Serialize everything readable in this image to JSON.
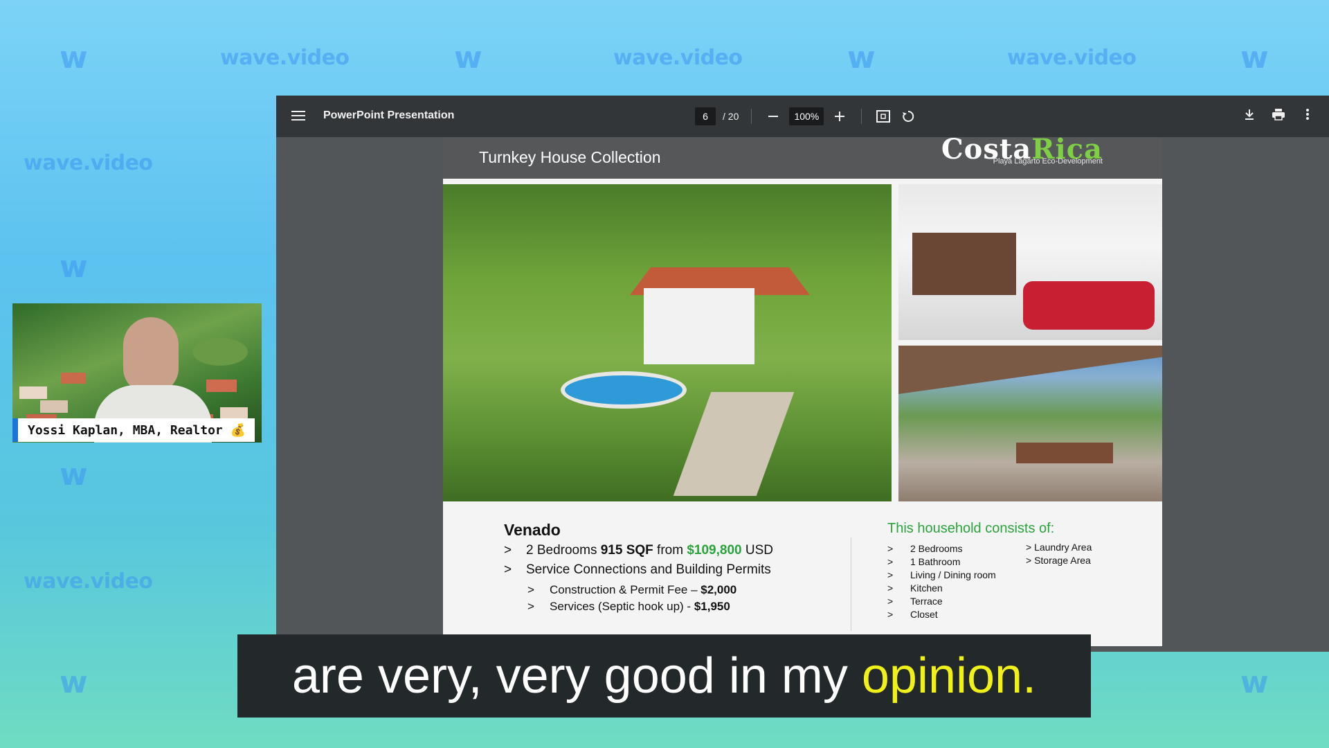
{
  "watermark": {
    "word": "wave.video",
    "logo": "w"
  },
  "presenter": {
    "name": "Yossi Kaplan, MBA, Realtor 💰"
  },
  "viewer": {
    "title": "PowerPoint Presentation",
    "page_current": "6",
    "page_total": "/ 20",
    "zoom": "100%",
    "icons": [
      "menu-icon",
      "zoom-out-icon",
      "zoom-in-icon",
      "fit-page-icon",
      "rotate-icon",
      "download-icon",
      "print-icon",
      "more-icon"
    ]
  },
  "slide": {
    "header_title": "Turnkey House Collection",
    "brand_a": "Costa",
    "brand_b": "Rica",
    "brand_sub": "Playa Lagarto Eco-Development",
    "model_name": "Venado",
    "line1_a": "2 Bedrooms ",
    "line1_b": "915 SQF",
    "line1_c": " from ",
    "line1_price": "$109,800",
    "line1_d": " USD",
    "line2": "Service Connections and Building Permits",
    "sub1_label": "Construction & Permit Fee – ",
    "sub1_price": "$2,000",
    "sub2_label": "Services (Septic hook up) - ",
    "sub2_price": "$1,950",
    "household_title": "This household consists of:",
    "household_left": [
      "2 Bedrooms",
      "1 Bathroom",
      "Living / Dining room",
      "Kitchen",
      "Terrace",
      "Closet"
    ],
    "household_right": [
      "Laundry Area",
      "Storage Area"
    ],
    "bullet": ">"
  },
  "subtitle": {
    "text": "are very, very good in my ",
    "highlight": "opinion."
  },
  "colors": {
    "accent_green": "#2aa33c",
    "toolbar": "#323639",
    "subtitle_highlight": "#f1f11a"
  }
}
